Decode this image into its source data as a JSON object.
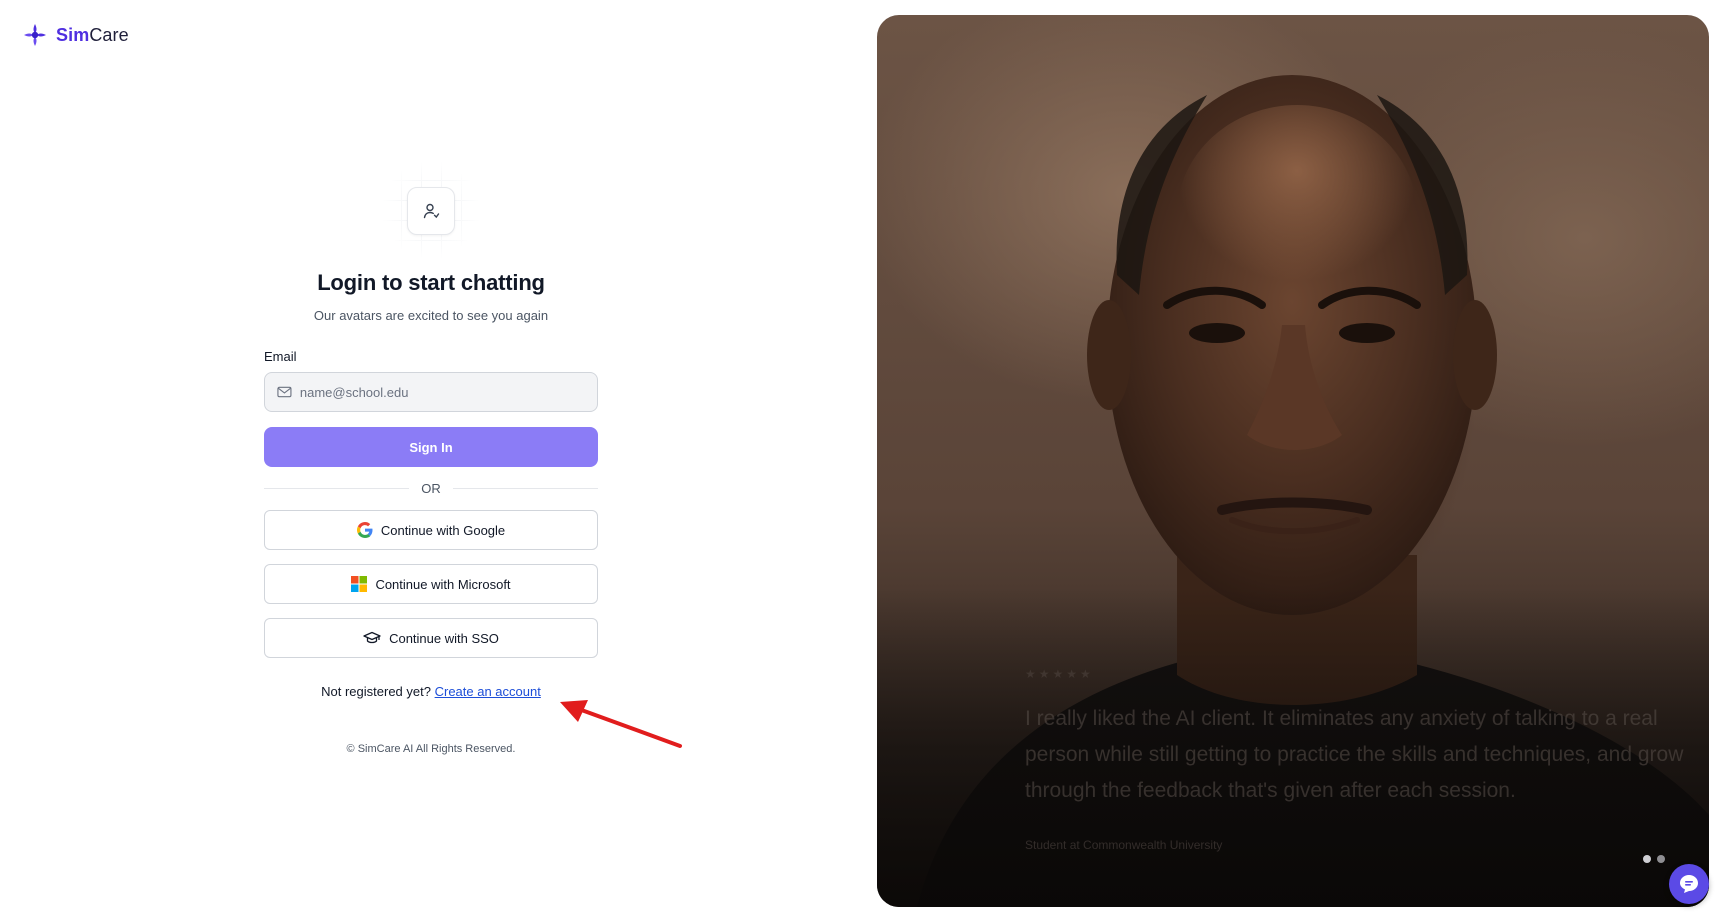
{
  "brand": {
    "name_part1": "Sim",
    "name_part2": "Care",
    "accent": "#4f2fe0"
  },
  "login": {
    "title": "Login to start chatting",
    "subtitle": "Our avatars are excited to see you again",
    "email_label": "Email",
    "email_placeholder": "name@school.edu",
    "email_value": "",
    "signin_label": "Sign In",
    "or_text": "OR",
    "google_label": "Continue with Google",
    "microsoft_label": "Continue with Microsoft",
    "sso_label": "Continue with SSO",
    "register_prompt": "Not registered yet?",
    "register_link": "Create an account",
    "copyright": "© SimCare AI All Rights Reserved."
  },
  "hero": {
    "testimonial": "I really liked the AI client. It eliminates any anxiety of talking to a real person while still getting to practice the skills and techniques, and grow through the feedback that's given after each session.",
    "author": "Student at Commonwealth University",
    "slides_total": 2,
    "slide_active": 1
  },
  "colors": {
    "primary_button": "#8b7cf6",
    "link": "#1d4ed8",
    "annotation_arrow": "#e11d1d",
    "chat_button": "#5b4ae6"
  },
  "icons": [
    "simcare-logo-icon",
    "user-icon",
    "mail-icon",
    "google-icon",
    "microsoft-icon",
    "graduation-cap-icon",
    "chat-icon"
  ]
}
